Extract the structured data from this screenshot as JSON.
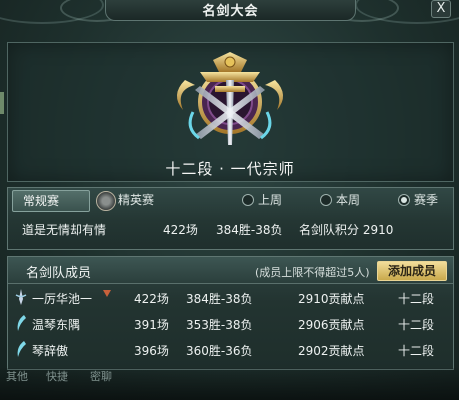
{
  "window": {
    "title": "名剑大会",
    "close_label": "X"
  },
  "profile": {
    "rank_title": "十二段 · 一代宗师"
  },
  "season_tabs": {
    "regular": "常规赛",
    "elite": "精英赛"
  },
  "season_filter": {
    "options": [
      {
        "label": "上周",
        "selected": false
      },
      {
        "label": "本周",
        "selected": false
      },
      {
        "label": "赛季",
        "selected": true
      }
    ]
  },
  "team_summary": {
    "name": "道是无情却有情",
    "matches": "422场",
    "record": "384胜-38负",
    "score": "名剑队积分 2910"
  },
  "members_panel": {
    "title": "名剑队成员",
    "limit_note": "(成员上限不得超过5人)",
    "add_button": "添加成员",
    "rows": [
      {
        "name": "一厉华池一",
        "matches": "422场",
        "record": "384胜-38负",
        "points": "2910贡献点",
        "rank": "十二段",
        "leader": true
      },
      {
        "name": "温琴东隅",
        "matches": "391场",
        "record": "353胜-38负",
        "points": "2906贡献点",
        "rank": "十二段",
        "leader": false
      },
      {
        "name": "琴辞傲",
        "matches": "396场",
        "record": "360胜-36负",
        "points": "2902贡献点",
        "rank": "十二段",
        "leader": false
      }
    ]
  },
  "bottom_bar": {
    "items": [
      "其他",
      "快捷",
      "密聊"
    ]
  },
  "colors": {
    "accent_gold": "#d9bf6a",
    "leader_mark": "#c8613b",
    "panel_border": "#5f7672"
  }
}
